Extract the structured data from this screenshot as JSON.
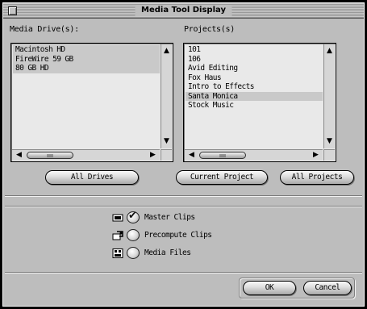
{
  "window": {
    "title": "Media Tool Display"
  },
  "media_drives": {
    "label": "Media Drive(s):",
    "items": [
      {
        "label": "Macintosh HD",
        "selected": true
      },
      {
        "label": "FireWire 59 GB",
        "selected": true
      },
      {
        "label": "80 GB HD",
        "selected": true
      }
    ],
    "button": "All Drives"
  },
  "projects": {
    "label": "Projects(s)",
    "items": [
      {
        "label": "101",
        "selected": false
      },
      {
        "label": "106",
        "selected": false
      },
      {
        "label": "Avid Editing",
        "selected": false
      },
      {
        "label": "Fox Haus",
        "selected": false
      },
      {
        "label": "Intro to Effects",
        "selected": false
      },
      {
        "label": "Santa Monica",
        "selected": true
      },
      {
        "label": "Stock Music",
        "selected": false
      }
    ],
    "current_button": "Current Project",
    "all_button": "All Projects"
  },
  "options": {
    "master_clips": {
      "label": "Master Clips",
      "checked": true,
      "icon": "master-clip-icon"
    },
    "precompute_clips": {
      "label": "Precompute Clips",
      "checked": false,
      "icon": "precompute-clip-icon"
    },
    "media_files": {
      "label": "Media Files",
      "checked": false,
      "icon": "media-file-icon"
    }
  },
  "actions": {
    "ok": "OK",
    "cancel": "Cancel"
  }
}
